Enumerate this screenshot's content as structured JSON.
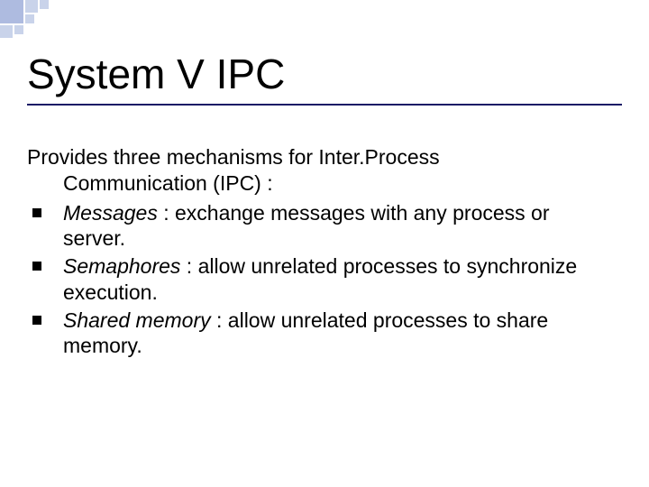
{
  "title": "System V IPC",
  "intro_line1": "Provides three mechanisms for  Inter.Process",
  "intro_line2": "Communication (IPC) :",
  "bullets": [
    {
      "term": "Messages",
      "rest": " : exchange messages with any process or server."
    },
    {
      "term": "Semaphores",
      "rest": " : allow unrelated processes to synchronize execution."
    },
    {
      "term": "Shared memory",
      "rest": " : allow unrelated processes to share memory."
    }
  ]
}
